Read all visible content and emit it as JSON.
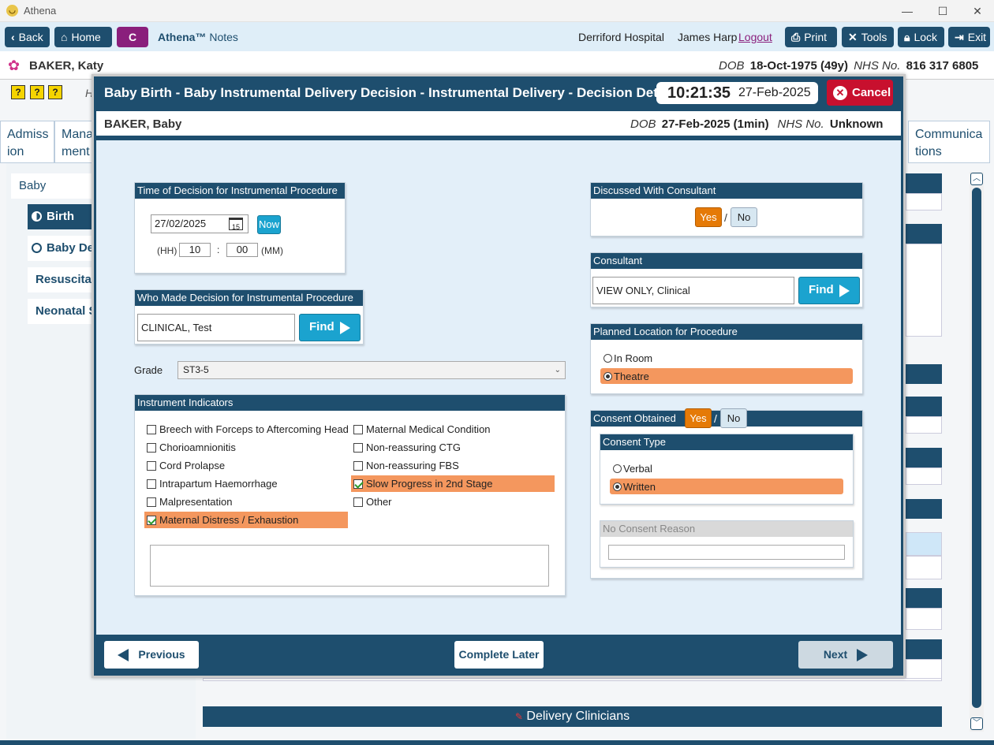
{
  "window": {
    "title": "Athena",
    "minimize": "—",
    "maximize": "☐",
    "close": "✕"
  },
  "toolbar": {
    "back": "Back",
    "home": "Home",
    "c_button": "C",
    "brand_name": "Athena™",
    "brand_suffix": "Notes",
    "hospital": "Derriford Hospital",
    "user": "James Harp",
    "logout": "Logout",
    "print": "Print",
    "tools": "Tools",
    "lock": "Lock",
    "exit": "Exit"
  },
  "patient": {
    "name": "BAKER, Katy",
    "dob_label": "DOB",
    "dob": "18-Oct-1975 (49y)",
    "nhs_label": "NHS No.",
    "nhs": "816 317 6805"
  },
  "background": {
    "tabs": [
      "Admiss ion",
      "Mana ment",
      "Communica tions"
    ],
    "nav": [
      "Baby",
      "Birth",
      "Baby De",
      "Resuscitati",
      "Neonatal S"
    ],
    "delivery_clinicians": "Delivery Clinicians",
    "h_fragment": "H"
  },
  "modal": {
    "title": "Baby Birth - Baby Instrumental Delivery Decision - Instrumental Delivery - Decision Details",
    "time": "10:21:35",
    "date": "27-Feb-2025",
    "cancel": "Cancel",
    "baby_name": "BAKER, Baby",
    "baby_dob_label": "DOB",
    "baby_dob": "27-Feb-2025 (1min)",
    "baby_nhs_label": "NHS No.",
    "baby_nhs": "Unknown"
  },
  "decision_time": {
    "header": "Time of Decision for Instrumental Procedure",
    "date_value": "27/02/2025",
    "cal_icon_num": "15",
    "now": "Now",
    "hh_label": "(HH)",
    "hh": "10",
    "colon": ":",
    "mm": "00",
    "mm_label": "(MM)"
  },
  "who_made": {
    "header": "Who Made Decision for Instrumental Procedure",
    "value": "CLINICAL, Test",
    "find": "Find"
  },
  "grade": {
    "label": "Grade",
    "value": "ST3-5"
  },
  "indicators": {
    "header": "Instrument Indicators",
    "items": [
      {
        "label": "Breech with Forceps to Aftercoming Head",
        "checked": false
      },
      {
        "label": "Chorioamnionitis",
        "checked": false
      },
      {
        "label": "Cord Prolapse",
        "checked": false
      },
      {
        "label": "Intrapartum Haemorrhage",
        "checked": false
      },
      {
        "label": "Malpresentation",
        "checked": false
      },
      {
        "label": "Maternal Distress / Exhaustion",
        "checked": true
      },
      {
        "label": "Maternal Medical Condition",
        "checked": false
      },
      {
        "label": "Non-reassuring CTG",
        "checked": false
      },
      {
        "label": "Non-reassuring FBS",
        "checked": false
      },
      {
        "label": "Slow Progress in 2nd Stage",
        "checked": true
      },
      {
        "label": "Other",
        "checked": false
      }
    ],
    "notes": ""
  },
  "discussed": {
    "header": "Discussed With Consultant",
    "yes": "Yes",
    "slash": "/",
    "no": "No",
    "selected": "Yes"
  },
  "consultant": {
    "header": "Consultant",
    "value": "VIEW ONLY, Clinical",
    "find": "Find"
  },
  "location": {
    "header": "Planned Location for Procedure",
    "options": [
      "In Room",
      "Theatre"
    ],
    "selected": "Theatre"
  },
  "consent": {
    "header": "Consent Obtained",
    "yes": "Yes",
    "slash": "/",
    "no": "No",
    "selected": "Yes",
    "type_header": "Consent Type",
    "type_options": [
      "Verbal",
      "Written"
    ],
    "type_selected": "Written",
    "no_reason_header": "No Consent Reason",
    "no_reason_value": ""
  },
  "footer": {
    "previous": "Previous",
    "complete_later": "Complete Later",
    "next": "Next"
  },
  "colors": {
    "navy": "#1e4e6e",
    "orange": "#e57a07",
    "highlight": "#f4975e",
    "cancel_red": "#c8102e",
    "find_blue": "#1ba3cf"
  }
}
